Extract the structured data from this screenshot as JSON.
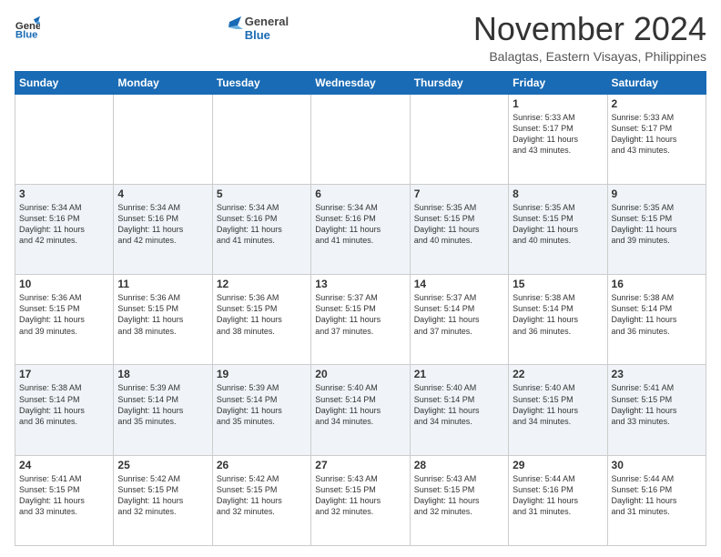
{
  "header": {
    "logo_line1": "General",
    "logo_line2": "Blue",
    "month": "November 2024",
    "location": "Balagtas, Eastern Visayas, Philippines"
  },
  "weekdays": [
    "Sunday",
    "Monday",
    "Tuesday",
    "Wednesday",
    "Thursday",
    "Friday",
    "Saturday"
  ],
  "weeks": [
    [
      {
        "day": "",
        "info": ""
      },
      {
        "day": "",
        "info": ""
      },
      {
        "day": "",
        "info": ""
      },
      {
        "day": "",
        "info": ""
      },
      {
        "day": "",
        "info": ""
      },
      {
        "day": "1",
        "info": "Sunrise: 5:33 AM\nSunset: 5:17 PM\nDaylight: 11 hours\nand 43 minutes."
      },
      {
        "day": "2",
        "info": "Sunrise: 5:33 AM\nSunset: 5:17 PM\nDaylight: 11 hours\nand 43 minutes."
      }
    ],
    [
      {
        "day": "3",
        "info": "Sunrise: 5:34 AM\nSunset: 5:16 PM\nDaylight: 11 hours\nand 42 minutes."
      },
      {
        "day": "4",
        "info": "Sunrise: 5:34 AM\nSunset: 5:16 PM\nDaylight: 11 hours\nand 42 minutes."
      },
      {
        "day": "5",
        "info": "Sunrise: 5:34 AM\nSunset: 5:16 PM\nDaylight: 11 hours\nand 41 minutes."
      },
      {
        "day": "6",
        "info": "Sunrise: 5:34 AM\nSunset: 5:16 PM\nDaylight: 11 hours\nand 41 minutes."
      },
      {
        "day": "7",
        "info": "Sunrise: 5:35 AM\nSunset: 5:15 PM\nDaylight: 11 hours\nand 40 minutes."
      },
      {
        "day": "8",
        "info": "Sunrise: 5:35 AM\nSunset: 5:15 PM\nDaylight: 11 hours\nand 40 minutes."
      },
      {
        "day": "9",
        "info": "Sunrise: 5:35 AM\nSunset: 5:15 PM\nDaylight: 11 hours\nand 39 minutes."
      }
    ],
    [
      {
        "day": "10",
        "info": "Sunrise: 5:36 AM\nSunset: 5:15 PM\nDaylight: 11 hours\nand 39 minutes."
      },
      {
        "day": "11",
        "info": "Sunrise: 5:36 AM\nSunset: 5:15 PM\nDaylight: 11 hours\nand 38 minutes."
      },
      {
        "day": "12",
        "info": "Sunrise: 5:36 AM\nSunset: 5:15 PM\nDaylight: 11 hours\nand 38 minutes."
      },
      {
        "day": "13",
        "info": "Sunrise: 5:37 AM\nSunset: 5:15 PM\nDaylight: 11 hours\nand 37 minutes."
      },
      {
        "day": "14",
        "info": "Sunrise: 5:37 AM\nSunset: 5:14 PM\nDaylight: 11 hours\nand 37 minutes."
      },
      {
        "day": "15",
        "info": "Sunrise: 5:38 AM\nSunset: 5:14 PM\nDaylight: 11 hours\nand 36 minutes."
      },
      {
        "day": "16",
        "info": "Sunrise: 5:38 AM\nSunset: 5:14 PM\nDaylight: 11 hours\nand 36 minutes."
      }
    ],
    [
      {
        "day": "17",
        "info": "Sunrise: 5:38 AM\nSunset: 5:14 PM\nDaylight: 11 hours\nand 36 minutes."
      },
      {
        "day": "18",
        "info": "Sunrise: 5:39 AM\nSunset: 5:14 PM\nDaylight: 11 hours\nand 35 minutes."
      },
      {
        "day": "19",
        "info": "Sunrise: 5:39 AM\nSunset: 5:14 PM\nDaylight: 11 hours\nand 35 minutes."
      },
      {
        "day": "20",
        "info": "Sunrise: 5:40 AM\nSunset: 5:14 PM\nDaylight: 11 hours\nand 34 minutes."
      },
      {
        "day": "21",
        "info": "Sunrise: 5:40 AM\nSunset: 5:14 PM\nDaylight: 11 hours\nand 34 minutes."
      },
      {
        "day": "22",
        "info": "Sunrise: 5:40 AM\nSunset: 5:15 PM\nDaylight: 11 hours\nand 34 minutes."
      },
      {
        "day": "23",
        "info": "Sunrise: 5:41 AM\nSunset: 5:15 PM\nDaylight: 11 hours\nand 33 minutes."
      }
    ],
    [
      {
        "day": "24",
        "info": "Sunrise: 5:41 AM\nSunset: 5:15 PM\nDaylight: 11 hours\nand 33 minutes."
      },
      {
        "day": "25",
        "info": "Sunrise: 5:42 AM\nSunset: 5:15 PM\nDaylight: 11 hours\nand 32 minutes."
      },
      {
        "day": "26",
        "info": "Sunrise: 5:42 AM\nSunset: 5:15 PM\nDaylight: 11 hours\nand 32 minutes."
      },
      {
        "day": "27",
        "info": "Sunrise: 5:43 AM\nSunset: 5:15 PM\nDaylight: 11 hours\nand 32 minutes."
      },
      {
        "day": "28",
        "info": "Sunrise: 5:43 AM\nSunset: 5:15 PM\nDaylight: 11 hours\nand 32 minutes."
      },
      {
        "day": "29",
        "info": "Sunrise: 5:44 AM\nSunset: 5:16 PM\nDaylight: 11 hours\nand 31 minutes."
      },
      {
        "day": "30",
        "info": "Sunrise: 5:44 AM\nSunset: 5:16 PM\nDaylight: 11 hours\nand 31 minutes."
      }
    ]
  ]
}
